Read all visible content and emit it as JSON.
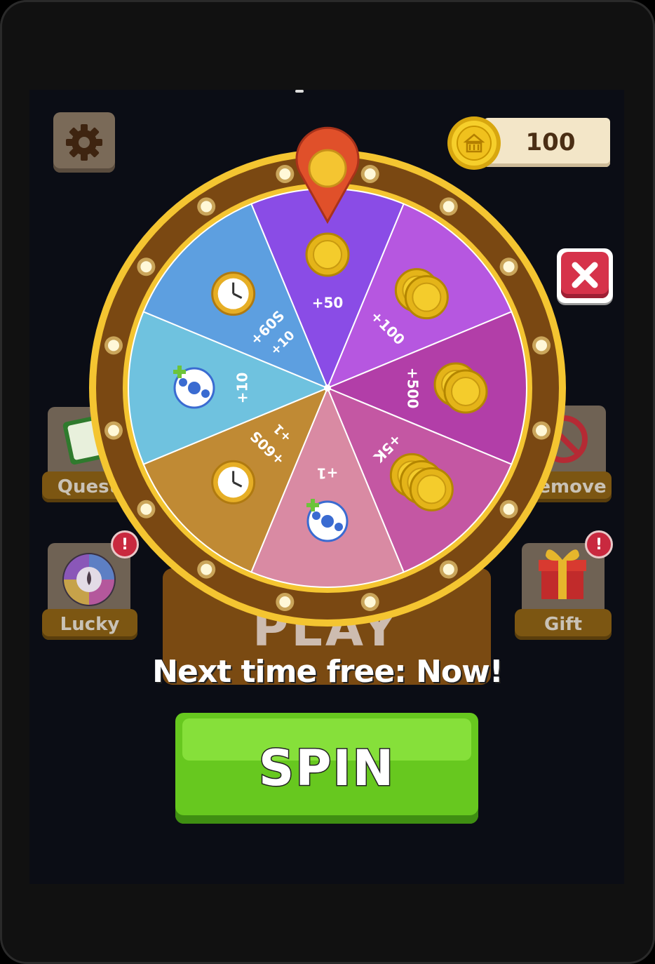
{
  "hud": {
    "coins": "100",
    "settings_icon": "gear-icon",
    "coin_icon": "coin-icon",
    "close_icon": "close-icon"
  },
  "side_buttons": {
    "quest_label": "Quest",
    "remove_label": "Remove",
    "lucky_label": "Lucky",
    "gift_label": "Gift",
    "alert_mark": "!"
  },
  "background": {
    "play_label": "PLAY"
  },
  "wheel": {
    "segments": [
      {
        "label": "+50",
        "icon": "coin-icon",
        "color": "#8a4ce6"
      },
      {
        "label": "+100",
        "icon": "coins-icon",
        "color": "#b657e0"
      },
      {
        "label": "+500",
        "icon": "coins-icon",
        "color": "#b23ea8"
      },
      {
        "label": "+5K",
        "icon": "coin-pile-icon",
        "color": "#c457a3"
      },
      {
        "label": "+1",
        "icon": "soccer-ball-icon",
        "color": "#d98aa3"
      },
      {
        "label": "+60S",
        "sublabel": "+1",
        "icon": "stopwatch-icon",
        "color": "#c08a34"
      },
      {
        "label": "+10",
        "icon": "soccer-ball-icon",
        "color": "#6fc2df"
      },
      {
        "label": "+60S",
        "sublabel": "+10",
        "icon": "stopwatch-icon",
        "color": "#5d9fe0"
      }
    ],
    "pointer_icon": "pointer-icon"
  },
  "footer": {
    "next_free": "Next time free: Now!",
    "spin_label": "SPIN"
  },
  "colors": {
    "spin_green": "#67c81f",
    "close_red": "#d6324a",
    "wheel_gold": "#f1c232"
  }
}
